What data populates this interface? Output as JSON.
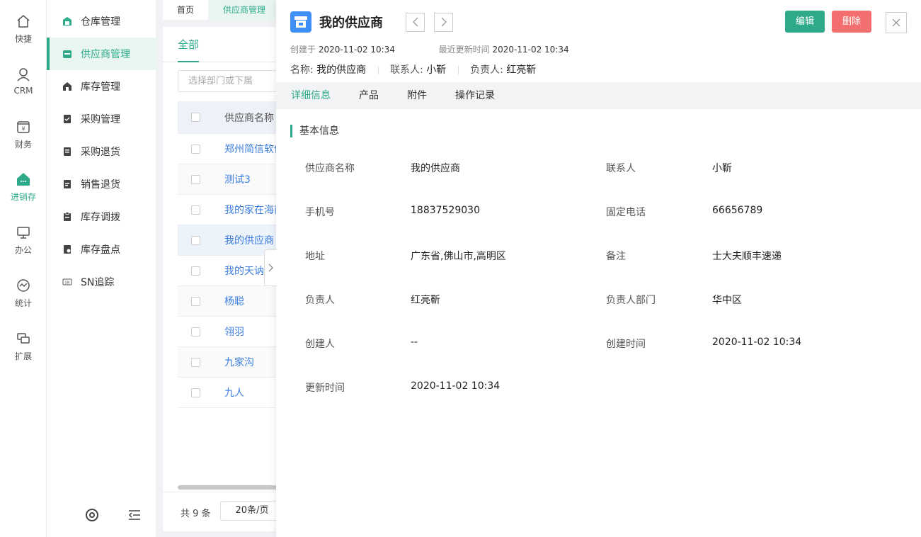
{
  "rail": [
    {
      "label": "快捷",
      "icon": "home-outline-icon"
    },
    {
      "label": "CRM",
      "icon": "person-icon"
    },
    {
      "label": "财务",
      "icon": "yen-wallet-icon"
    },
    {
      "label": "进销存",
      "icon": "store-house-icon",
      "active": true
    },
    {
      "label": "办公",
      "icon": "monitor-icon"
    },
    {
      "label": "统计",
      "icon": "chart-circle-icon"
    },
    {
      "label": "扩展",
      "icon": "extension-icon"
    }
  ],
  "submenu": [
    {
      "label": "仓库管理",
      "icon": "warehouse-icon"
    },
    {
      "label": "供应商管理",
      "icon": "supplier-store-icon",
      "active": true
    },
    {
      "label": "库存管理",
      "icon": "inventory-house-icon"
    },
    {
      "label": "采购管理",
      "icon": "purchase-doc-icon"
    },
    {
      "label": "采购退货",
      "icon": "purchase-return-icon"
    },
    {
      "label": "销售退货",
      "icon": "sales-return-icon"
    },
    {
      "label": "库存调拨",
      "icon": "transfer-clipboard-icon"
    },
    {
      "label": "库存盘点",
      "icon": "stocktake-icon"
    },
    {
      "label": "SN追踪",
      "icon": "sn-tag-icon"
    }
  ],
  "tabs": [
    {
      "label": "首页"
    },
    {
      "label": "供应商管理"
    }
  ],
  "list": {
    "tab_all": "全部",
    "filter_placeholder": "选择部门或下属",
    "column_name": "供应商名称",
    "rows": [
      "郑州简信软件",
      "测试3",
      "我的家在海南",
      "我的供应商",
      "我的天讷",
      "杨聪",
      "翎羽",
      "九家沟",
      "九人"
    ],
    "total": "共 9 条",
    "page_size": "20条/页"
  },
  "drawer": {
    "title": "我的供应商",
    "edit_label": "编辑",
    "delete_label": "删除",
    "created_label": "创建于",
    "created_value": "2020-11-02 10:34",
    "updated_label": "最近更新时间",
    "updated_value": "2020-11-02 10:34",
    "summary": {
      "name_label": "名称:",
      "name_value": "我的供应商",
      "contact_label": "联系人:",
      "contact_value": "小靳",
      "owner_label": "负责人:",
      "owner_value": "红亮靳"
    },
    "tabs": [
      "详细信息",
      "产品",
      "附件",
      "操作记录"
    ],
    "section_title": "基本信息",
    "fields": [
      {
        "label": "供应商名称",
        "value": "我的供应商"
      },
      {
        "label": "联系人",
        "value": "小靳"
      },
      {
        "label": "手机号",
        "value": "18837529030"
      },
      {
        "label": "固定电话",
        "value": "66656789"
      },
      {
        "label": "地址",
        "value": "广东省,佛山市,高明区"
      },
      {
        "label": "备注",
        "value": "士大夫顺丰速递"
      },
      {
        "label": "负责人",
        "value": "红亮靳"
      },
      {
        "label": "负责人部门",
        "value": "华中区"
      },
      {
        "label": "创建人",
        "value": "--"
      },
      {
        "label": "创建时间",
        "value": "2020-11-02 10:34"
      },
      {
        "label": "更新时间",
        "value": "2020-11-02 10:34"
      }
    ]
  },
  "colors": {
    "accent": "#2eaa8a",
    "danger": "#f36f6f",
    "link": "#3a7dde",
    "brand_blue": "#3e8ff5"
  }
}
